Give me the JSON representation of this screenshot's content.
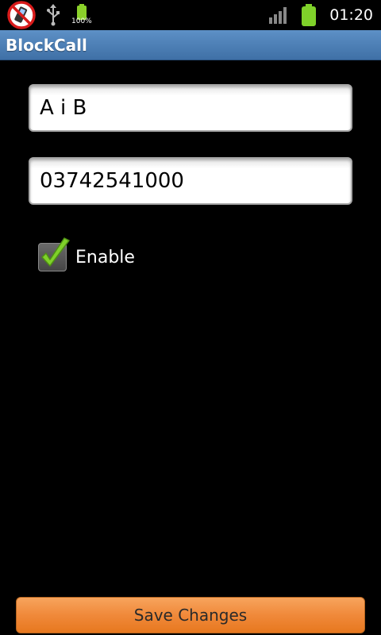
{
  "status_bar": {
    "battery_percent_label": "100%",
    "time": "01:20",
    "icons": [
      "no-calls-icon",
      "usb-icon",
      "battery-small-icon",
      "signal-icon",
      "battery-icon"
    ]
  },
  "app": {
    "title": "BlockCall"
  },
  "form": {
    "name_value": "A i B",
    "number_value": "03742541000",
    "enable_label": "Enable",
    "enable_checked": true
  },
  "actions": {
    "save_label": "Save Changes"
  },
  "colors": {
    "title_bar": "#4a7eb6",
    "button": "#f0893a",
    "check": "#7fd12a"
  }
}
